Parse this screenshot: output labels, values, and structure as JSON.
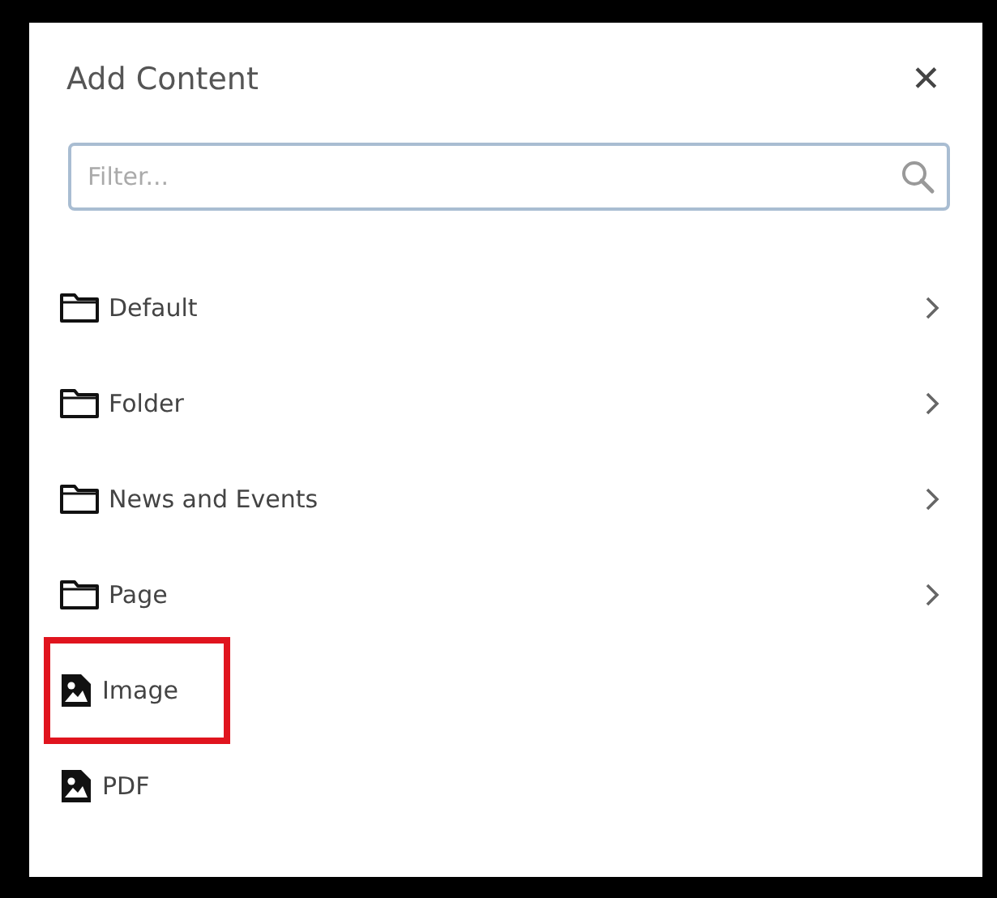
{
  "dialog": {
    "title": "Add Content",
    "close": "✕"
  },
  "filter": {
    "placeholder": "Filter..."
  },
  "items": [
    {
      "label": "Default",
      "kind": "folder",
      "has_children": true,
      "highlighted": false
    },
    {
      "label": "Folder",
      "kind": "folder",
      "has_children": true,
      "highlighted": false
    },
    {
      "label": "News and Events",
      "kind": "folder",
      "has_children": true,
      "highlighted": false
    },
    {
      "label": "Page",
      "kind": "folder",
      "has_children": true,
      "highlighted": false
    },
    {
      "label": "Image",
      "kind": "file",
      "has_children": false,
      "highlighted": true
    },
    {
      "label": "PDF",
      "kind": "file",
      "has_children": false,
      "highlighted": false
    }
  ]
}
